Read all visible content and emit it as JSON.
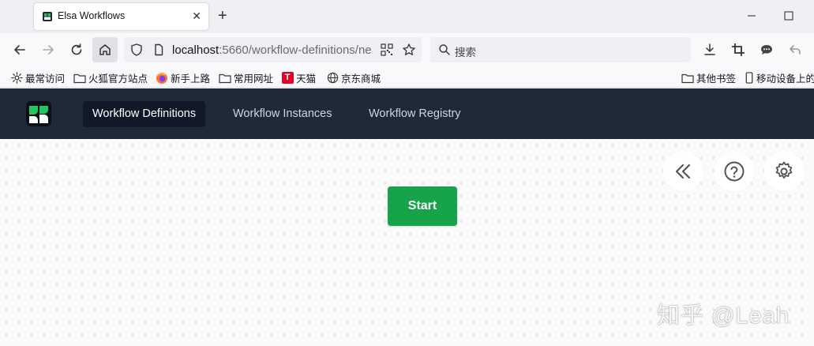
{
  "browser": {
    "tab": {
      "title": "Elsa Workflows",
      "close_glyph": "✕"
    },
    "new_tab_glyph": "+",
    "url": {
      "host": "localhost",
      "rest": ":5660/workflow-definitions/ne"
    },
    "search": {
      "placeholder": "搜索"
    },
    "bookmarks": [
      {
        "icon": "gear-icon",
        "label": "最常访问"
      },
      {
        "icon": "folder-icon",
        "label": "火狐官方站点"
      },
      {
        "icon": "firefox-icon",
        "label": "新手上路"
      },
      {
        "icon": "folder-icon",
        "label": "常用网址"
      },
      {
        "icon": "tmall-icon",
        "icon_text": "T",
        "label": "天猫"
      },
      {
        "icon": "globe-icon",
        "label": "京东商城"
      }
    ],
    "bookmarks_right": [
      {
        "icon": "folder-icon",
        "label": "其他书签"
      },
      {
        "icon": "mobile-icon",
        "label": "移动设备上的"
      }
    ]
  },
  "app": {
    "nav": [
      {
        "label": "Workflow Definitions",
        "active": true
      },
      {
        "label": "Workflow Instances",
        "active": false
      },
      {
        "label": "Workflow Registry",
        "active": false
      }
    ],
    "canvas": {
      "start_node_label": "Start",
      "toolbar_icons": [
        "chevrons-left-icon",
        "help-circle-icon",
        "gear-icon"
      ]
    },
    "colors": {
      "header_bg": "#1f2937",
      "active_nav_bg": "#111827",
      "start_node": "#16a34a",
      "logo_green": "#22c55e"
    }
  },
  "watermark": "知乎 @Leah"
}
